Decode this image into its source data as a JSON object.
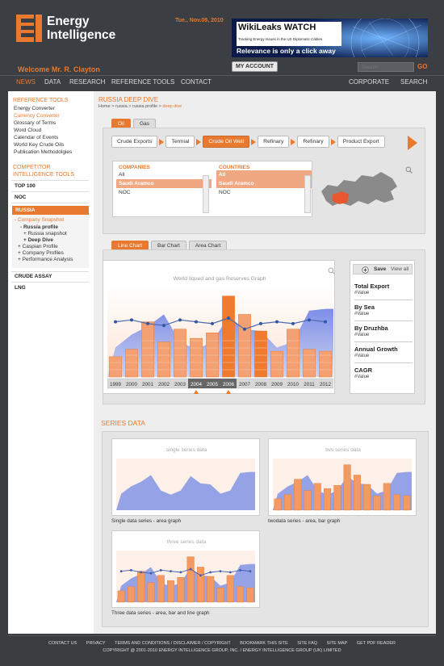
{
  "brand": {
    "name_line1": "Energy",
    "name_line2": "Intelligence"
  },
  "header": {
    "date": "Tue., Nov.09, 2010",
    "welcome": "Welcome Mr. R. Clayton",
    "my_account": "MY ACCOUNT",
    "search_placeholder": "Search",
    "go": "GO"
  },
  "banner": {
    "title": "WikiLeaks WATCH",
    "subtitle": "Tracking Energy Issues in the US Diplomatic Cables",
    "tagline": "Relevance is only a click away"
  },
  "nav": {
    "left": [
      "NEWS",
      "DATA",
      "RESEARCH",
      "REFERENCE TOOLS",
      "CONTACT"
    ],
    "right": [
      "CORPORATE",
      "SEARCH"
    ],
    "active": "NEWS"
  },
  "sidebar": {
    "ref_title": "REFERENCE TOOLS",
    "ref_links": [
      "Energy Converter",
      "Currency Converter",
      "Glossary of Terms",
      "Word Cloud",
      "Calendar of Events",
      "World Key Crude Oils",
      "Publication Methodolgies"
    ],
    "ref_active": "Currency Converter",
    "ci_title_1": "COMPETITOR",
    "ci_title_2": "INTELLIGENCE TOOLS",
    "top100": "TOP 100",
    "noc": "NOC",
    "russia": {
      "head": "RUSSIA",
      "snapshot": "- Company Snapshot",
      "profile": "- Russia profile",
      "snap": "+ Russia snapshot",
      "deep": "+ Deep Dive",
      "caspian": "+ Caspian Profile",
      "companies": "+ Company Profiles",
      "performance": "+ Performance  Analysis"
    },
    "crude_assay": "CRUDE ASSAY",
    "lng": "LNG"
  },
  "main": {
    "title": "RUSSIA DEEP DIVE",
    "breadcrumb": [
      "Home",
      "russia",
      "russia profile",
      "deep dive"
    ],
    "breadcrumb_sep": " > ",
    "tabs": [
      "Oil",
      "Gas"
    ],
    "flow": [
      "Crude Exports",
      "Termial",
      "Crude Oil Well",
      "Refinary",
      "Refinary",
      "Product Export"
    ],
    "flow_active": "Crude Oil Well",
    "companies": {
      "header": "COMPANIES",
      "items": [
        "All",
        "Saudi Aramco",
        "NOC"
      ],
      "selected": "Saudi Aramco"
    },
    "countries": {
      "header": "COUNTRIES",
      "items": [
        "All",
        "Saudi Aramco",
        "NOC"
      ],
      "selected": "Saudi Aramco"
    },
    "chart_tabs": [
      "Line Chart",
      "Bar Chart",
      "Area Chart"
    ],
    "chart_tab_active": "Line Chart",
    "legend": {
      "save": "Save",
      "view_all": "View all",
      "items": [
        {
          "name": "Total Export",
          "value": "#Value"
        },
        {
          "name": "By Sea",
          "value": "#Value"
        },
        {
          "name": "By Druzhba",
          "value": "#Value"
        },
        {
          "name": "Annual Growth",
          "value": "#Value"
        },
        {
          "name": "CAGR",
          "value": "#Value"
        }
      ]
    },
    "series_title": "SERIES DATA",
    "thumbs": [
      {
        "title": "single series data",
        "caption": "Single data series - area graph"
      },
      {
        "title": "two series data",
        "caption": "twodata series - area, bar graph"
      },
      {
        "title": "three series data",
        "caption": "Three data series - area, bar and line graph"
      }
    ]
  },
  "chart_data": {
    "type": "bar",
    "title": "World liqued and gas Reserves Graph",
    "categories": [
      "1999",
      "2000",
      "2001",
      "2002",
      "2003",
      "2004",
      "2005",
      "2006",
      "2007",
      "2008",
      "2009",
      "2010",
      "2011",
      "2012"
    ],
    "highlighted_range": [
      "2004",
      "2006"
    ],
    "series": [
      {
        "values": [
          32,
          46,
          55,
          68,
          38,
          30,
          38,
          66,
          52,
          50,
          32,
          38,
          72,
          74
        ]
      },
      {
        "values": [
          22,
          30,
          60,
          38,
          52,
          42,
          48,
          88,
          68,
          50,
          28,
          52,
          30,
          28
        ]
      },
      {
        "values": [
          60,
          62,
          58,
          56,
          62,
          60,
          58,
          64,
          52,
          58,
          60,
          58,
          62,
          60
        ]
      }
    ],
    "ylim": [
      0,
      100
    ]
  },
  "footer": {
    "links": [
      "CONTACT US",
      "PRIVACY",
      "TERMS AND CONDITIONS / DISCLAIMER / COPYRIGHT",
      "BOOKMARK THIS SITE",
      "SITE FAQ",
      "SITE MAP",
      "GET PDF READER"
    ],
    "copyright": "COPYRIGHT @ 2001-2010 ENERGY INTELLIGENCE GROUP, INC. / ENERGY INTELLIGENCE GROUP (UK) LIMITED"
  },
  "colors": {
    "accent": "#e8792e",
    "area": "#7f8fe0",
    "line": "#4a6ab0",
    "dark": "#3b3e42"
  }
}
